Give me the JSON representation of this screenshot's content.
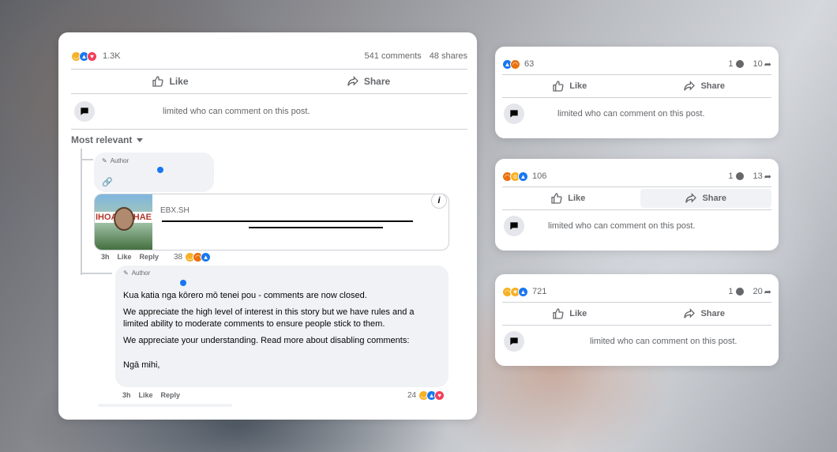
{
  "main_post": {
    "reaction_count": "1.3K",
    "comments": "541 comments",
    "shares": "48 shares",
    "like_label": "Like",
    "share_label": "Share",
    "limited_text": "limited who can comment on this post.",
    "sort_label": "Most relevant",
    "comment1": {
      "author_label": "Author",
      "link_domain": "EBX.SH",
      "time": "3h",
      "like": "Like",
      "reply": "Reply",
      "reaction_count": "38",
      "image_text_left": "IHOA",
      "image_text_right": "HAE"
    },
    "comment2": {
      "author_label": "Author",
      "line1": "Kua katia nga kōrero mō tenei pou - comments are now closed.",
      "line2": "We appreciate the high level of interest in this story but we have rules and a limited ability to moderate comments to ensure people stick to them.",
      "line3": "We appreciate your understanding. Read more about disabling comments:",
      "line4": "Ngā mihi,",
      "time": "3h",
      "like": "Like",
      "reply": "Reply",
      "reaction_count": "24"
    }
  },
  "side_posts": [
    {
      "reaction_count": "63",
      "comments": "1",
      "shares": "10",
      "like_label": "Like",
      "share_label": "Share",
      "limited_text": "limited who can comment on this post."
    },
    {
      "reaction_count": "106",
      "comments": "1",
      "shares": "13",
      "like_label": "Like",
      "share_label": "Share",
      "limited_text": "limited who can comment on this post."
    },
    {
      "reaction_count": "721",
      "comments": "1",
      "shares": "20",
      "like_label": "Like",
      "share_label": "Share",
      "limited_text": "limited who can comment on this post."
    }
  ],
  "colors": {
    "accent": "#1877f2",
    "muted": "#65676b",
    "bubble": "#f0f2f5"
  }
}
